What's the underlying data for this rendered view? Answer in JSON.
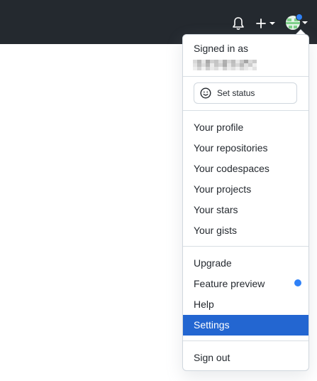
{
  "header": {
    "bell_icon": "bell-icon",
    "create_icon": "plus-icon",
    "avatar_icon": "avatar-icon",
    "notification_dot_color": "#2f81f7"
  },
  "menu": {
    "signed_in_label": "Signed in as",
    "set_status_label": "Set status",
    "profile_items": [
      "Your profile",
      "Your repositories",
      "Your codespaces",
      "Your projects",
      "Your stars",
      "Your gists"
    ],
    "extra_items": [
      "Upgrade",
      "Feature preview",
      "Help",
      "Settings"
    ],
    "active_item": "Settings",
    "sign_out_label": "Sign out",
    "accent_color": "#2366d1"
  }
}
